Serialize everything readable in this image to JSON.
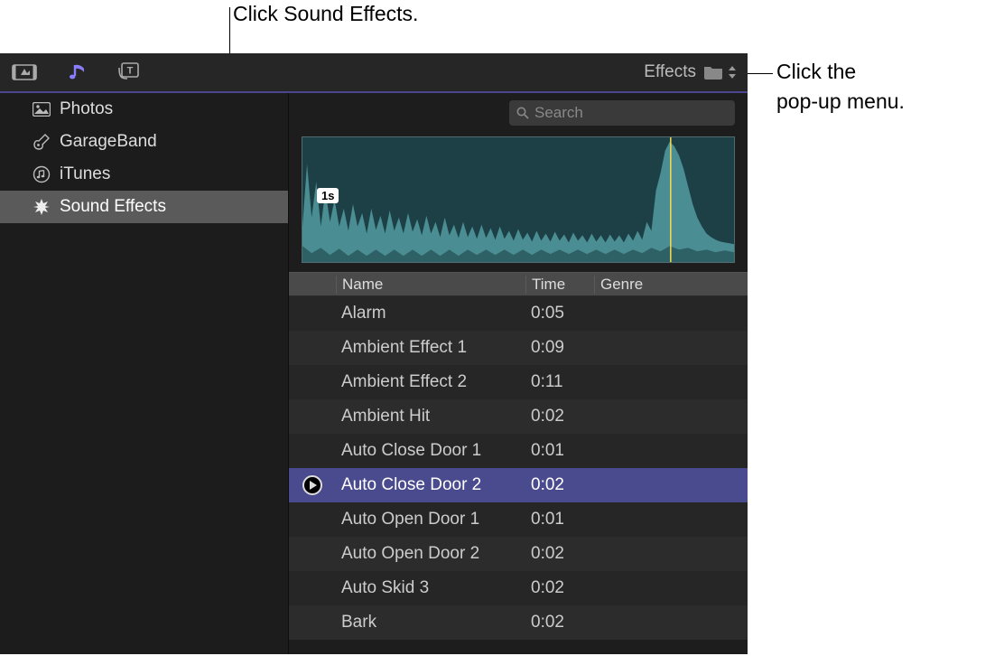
{
  "annotations": {
    "top": "Click Sound Effects.",
    "right_line1": "Click the",
    "right_line2": "pop-up menu."
  },
  "toolbar": {
    "effects_label": "Effects"
  },
  "sidebar": {
    "items": [
      {
        "label": "Photos",
        "icon": "photos"
      },
      {
        "label": "GarageBand",
        "icon": "guitar"
      },
      {
        "label": "iTunes",
        "icon": "itunes"
      },
      {
        "label": "Sound Effects",
        "icon": "burst"
      }
    ]
  },
  "search": {
    "placeholder": "Search"
  },
  "waveform": {
    "time_label": "1s"
  },
  "table": {
    "columns": {
      "name": "Name",
      "time": "Time",
      "genre": "Genre"
    },
    "rows": [
      {
        "name": "Alarm",
        "time": "0:05",
        "genre": ""
      },
      {
        "name": "Ambient Effect 1",
        "time": "0:09",
        "genre": ""
      },
      {
        "name": "Ambient Effect 2",
        "time": "0:11",
        "genre": ""
      },
      {
        "name": "Ambient Hit",
        "time": "0:02",
        "genre": ""
      },
      {
        "name": "Auto Close Door 1",
        "time": "0:01",
        "genre": ""
      },
      {
        "name": "Auto Close Door 2",
        "time": "0:02",
        "genre": ""
      },
      {
        "name": "Auto Open Door 1",
        "time": "0:01",
        "genre": ""
      },
      {
        "name": "Auto Open Door 2",
        "time": "0:02",
        "genre": ""
      },
      {
        "name": "Auto Skid 3",
        "time": "0:02",
        "genre": ""
      },
      {
        "name": "Bark",
        "time": "0:02",
        "genre": ""
      }
    ],
    "selected_index": 5
  }
}
